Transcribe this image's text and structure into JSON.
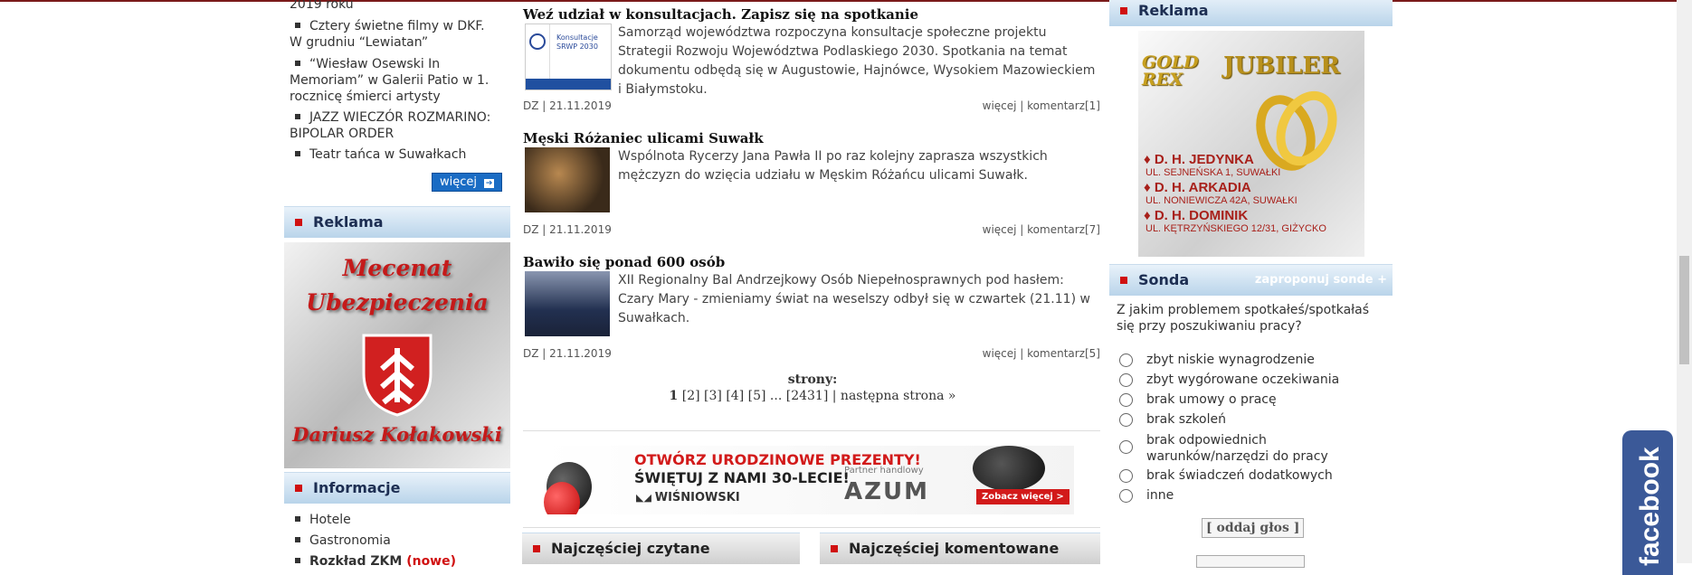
{
  "left": {
    "events": [
      {
        "label": "2019 roku"
      },
      {
        "label": "Cztery świetne filmy w DKF. W grudniu “Lewiatan”"
      },
      {
        "label": "“Wiesław Osewski In Memoriam” w Galerii Patio w 1. rocznicę śmierci artysty"
      },
      {
        "label": "JAZZ WIECZÓR ROZMARINO: BIPOLAR ORDER"
      },
      {
        "label": "Teatr tańca w Suwałkach"
      }
    ],
    "more_label": "więcej",
    "ad_title": "Reklama",
    "ad_text_top": "Mecenat",
    "ad_text_mid": "Ubezpieczenia",
    "ad_text_bottom": "Dariusz Kołakowski",
    "info_title": "Informacje",
    "info_items": [
      {
        "label": "Hotele"
      },
      {
        "label": "Gastronomia"
      },
      {
        "label": "Rozkład ZKM",
        "badge": "(nowe)"
      }
    ]
  },
  "articles": [
    {
      "title": "Weź udział w konsultacjach. Zapisz się na spotkanie",
      "text": "Samorząd województwa rozpoczyna konsultacje społeczne projektu Strategii Rozwoju Województwa Podlaskiego 2030. Spotkania na temat dokumentu odbędą się w Augustowie, Hajnówce, Wysokiem Mazowieckiem i Białymstoku.",
      "meta": "DZ | 21.11.2019",
      "more": "więcej",
      "comments": "komentarz[1]",
      "thumb_caption": "Konsultacje SRWP 2030"
    },
    {
      "title": "Męski Różaniec ulicami Suwałk",
      "text": "Wspólnota Rycerzy Jana Pawła II po raz kolejny zaprasza wszystkich mężczyzn do wzięcia udziału w Męskim Różańcu ulicami Suwałk.",
      "meta": "DZ | 21.11.2019",
      "more": "więcej",
      "comments": "komentarz[7]"
    },
    {
      "title": "Bawiło się ponad 600 osób",
      "text": "XII Regionalny Bal Andrzejkowy Osób Niepełnosprawnych pod hasłem: Czary Mary - zmieniamy świat na weselszy odbył się w czwartek (21.11) w Suwałkach.",
      "meta": "DZ | 21.11.2019",
      "more": "więcej",
      "comments": "komentarz[5]"
    }
  ],
  "pagination": {
    "label": "strony:",
    "current": "1",
    "pages": [
      "[2]",
      "[3]",
      "[4]",
      "[5]"
    ],
    "ellipsis": "...",
    "last": "[2431]",
    "sep": "|",
    "next": "następna strona »"
  },
  "banner": {
    "line1": "OTWÓRZ URODZINOWE PREZENTY!",
    "line2": "ŚWIĘTUJ Z NAMI 30-LECIE!",
    "brand": "WIŚNIOWSKI",
    "partner": "Partner handlowy",
    "partner_brand": "AZUM",
    "cta": "Zobacz więcej >"
  },
  "bottom_tabs": {
    "most_read": "Najczęściej czytane",
    "most_commented": "Najczęściej komentowane"
  },
  "right": {
    "ad_title": "Reklama",
    "jubiler": {
      "brand": "GOLD REX",
      "title": "JUBILER",
      "shops": [
        {
          "name": "D. H. JEDYNKA",
          "addr": "UL. SEJNEŃSKA 1, SUWAŁKI"
        },
        {
          "name": "D. H. ARKADIA",
          "addr": "UL. NONIEWICZA 42A, SUWAŁKI"
        },
        {
          "name": "D. H. DOMINIK",
          "addr": "UL. KĘTRZYŃSKIEGO 12/31, GIŻYCKO"
        }
      ]
    },
    "sonda_title": "Sonda",
    "sonda_propose": "zaproponuj sonde +",
    "question": "Z jakim problemem spotkałeś/spotkałaś się przy poszukiwaniu pracy?",
    "options": [
      {
        "label": "zbyt niskie wynagrodzenie"
      },
      {
        "label": "zbyt wygórowane oczekiwania"
      },
      {
        "label": "brak umowy o pracę"
      },
      {
        "label": "brak szkoleń"
      },
      {
        "label": "brak odpowiednich warunków/narzędzi do pracy"
      },
      {
        "label": "brak świadczeń dodatkowych"
      },
      {
        "label": "inne"
      }
    ],
    "vote_label": "[ oddaj głos ]"
  },
  "facebook_label": "facebook"
}
